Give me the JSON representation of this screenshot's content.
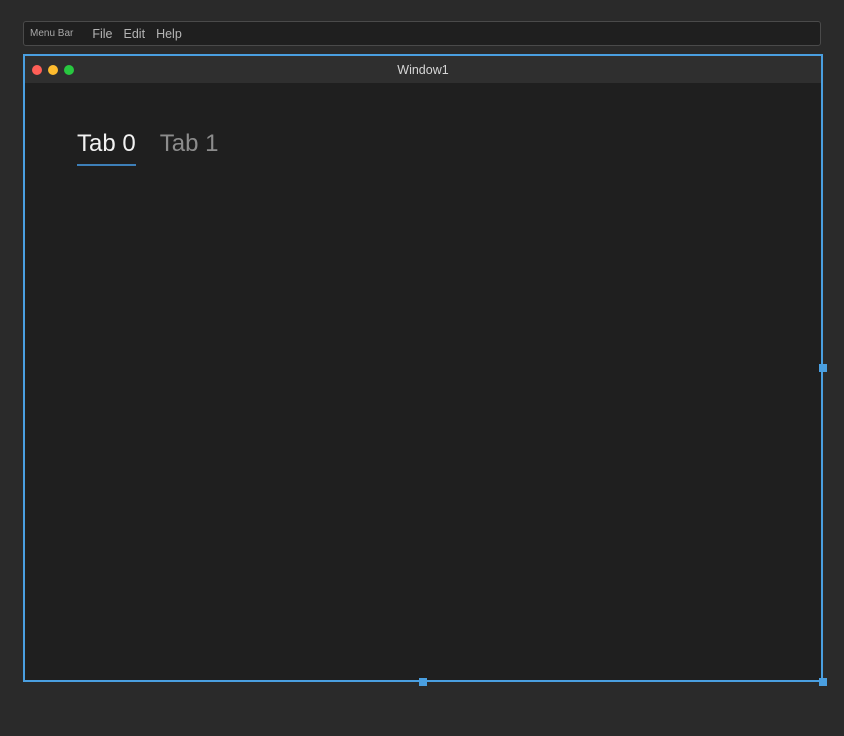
{
  "menubar": {
    "title": "Menu Bar",
    "items": [
      {
        "label": "File"
      },
      {
        "label": "Edit"
      },
      {
        "label": "Help"
      }
    ]
  },
  "window": {
    "title": "Window1",
    "tabs": [
      {
        "label": "Tab 0",
        "active": true
      },
      {
        "label": "Tab 1",
        "active": false
      }
    ]
  },
  "colors": {
    "accent": "#4a9fe0",
    "tab_underline": "#3d7fb8",
    "background": "#1f1f1f",
    "desktop": "#2a2a2a"
  }
}
